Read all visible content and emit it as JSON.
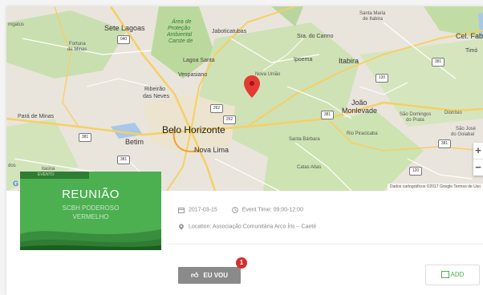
{
  "map": {
    "labels": {
      "sete_lagoas": "Sete Lagoas",
      "area_protecao_1": "Área de",
      "area_protecao_2": "Proteção",
      "area_protecao_3": "Ambiental",
      "area_protecao_4": "Carste de",
      "jaboticatubas": "Jaboticatubas",
      "santa_maria_1": "Santa Maria",
      "santa_maria_2": "de Itabira",
      "cel_fab": "Cel. Fab",
      "fortuna_1": "Fortuna",
      "fortuna_2": "de Minas",
      "sao_do_carmo": "Sra. do Carmo",
      "lagoa_santa": "Lagoa Santa",
      "ipoema": "Ipoema",
      "itabira": "Itabira",
      "timoteo": "Timó",
      "vespasiano": "Vespasiano",
      "nova_uniao": "Nova União",
      "ribeirao_1": "Ribeirão",
      "ribeirao_2": "das Neves",
      "joao_1": "João",
      "joao_2": "Monlevade",
      "sao_domingos_1": "São Domingos",
      "sao_domingos_2": "do Prata",
      "dionisio": "Dionísio",
      "para_de_minas": "Pará de Minas",
      "belo_horizonte": "Belo Horizonte",
      "rio_piracicaba": "Rio Piracicaba",
      "sao_jose_1": "São José",
      "sao_jose_2": "do Goiabal",
      "betim": "Betim",
      "santa_barbara": "Santa Bárbara",
      "nova_lima": "Nova Lima",
      "itaguara": "itaúna",
      "catas_altas": "Catas Altas",
      "left_edge_1": "rngatus",
      "left_edge_2": "dos",
      "left_edge_3": "Itaúna"
    },
    "shields": [
      "040",
      "381",
      "381",
      "262",
      "120",
      "262",
      "381",
      "381",
      "040",
      "120",
      "356",
      "381"
    ],
    "attribution": "Dados cartográficos ©2017 Google   Termos de Uso",
    "zoom_in": "+",
    "zoom_out": "−",
    "google": "G"
  },
  "thumbnail": {
    "tag": "EVENTO",
    "title": "REUNIÃO",
    "subtitle_1": "SCBH PODEROSO",
    "subtitle_2": "VERMELHO"
  },
  "event": {
    "date": "2017-03-15",
    "time_label": "Event Time: 09:00-12:00",
    "location": "Location: Associação Comunitária Arco Íris – Caeté"
  },
  "buttons": {
    "going_label": "EU VOU",
    "going_count": "1",
    "add_label": "ADD"
  },
  "colors": {
    "thumb_green": "#4caf50",
    "badge_red": "#d32f2f",
    "add_green": "#4caf50",
    "pin_red": "#e53935"
  },
  "icons": {
    "calendar": "calendar-icon",
    "clock": "clock-icon",
    "pin": "map-pin-icon",
    "hand": "thumbs-up-icon",
    "add_calendar": "calendar-add-icon"
  }
}
